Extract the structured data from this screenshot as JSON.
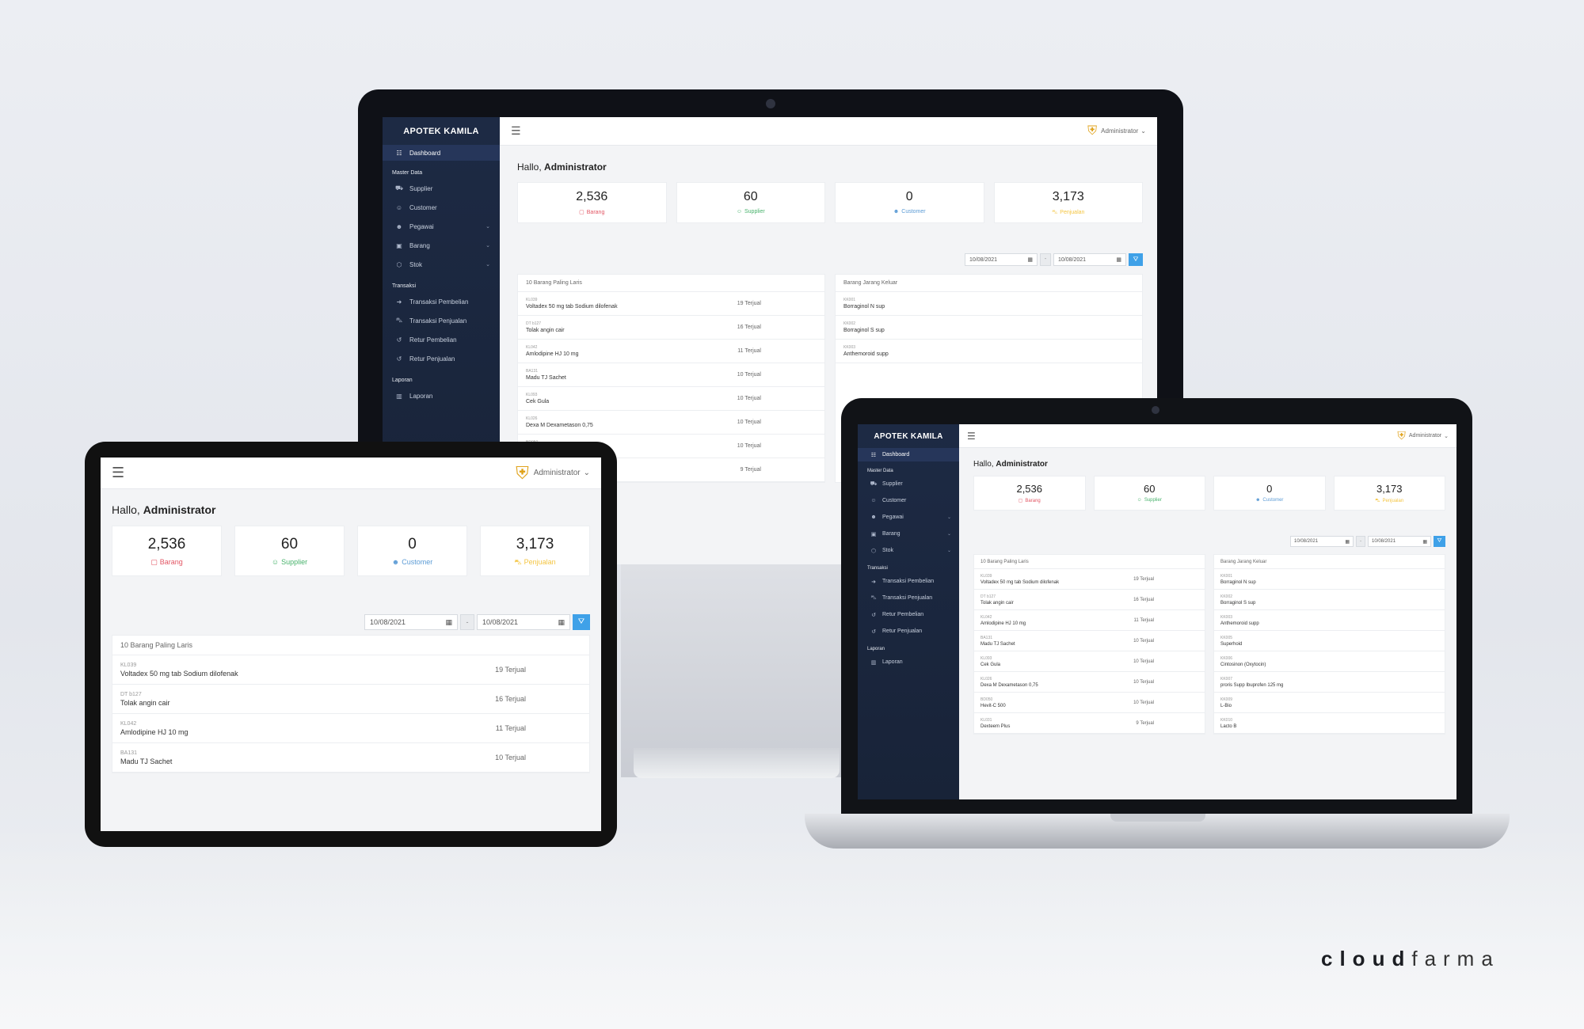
{
  "app": {
    "brand": "APOTEK KAMILA",
    "user": "Administrator",
    "greeting_prefix": "Hallo,",
    "greeting_name": "Administrator",
    "nav": {
      "dashboard": "Dashboard",
      "master_data": "Master Data",
      "supplier": "Supplier",
      "customer": "Customer",
      "pegawai": "Pegawai",
      "barang": "Barang",
      "stok": "Stok",
      "transaksi": "Transaksi",
      "transaksi_pembelian": "Transaksi Pembelian",
      "transaksi_penjualan": "Transaksi Penjualan",
      "retur_pembelian": "Retur Pembelian",
      "retur_penjualan": "Retur Penjualan",
      "laporan_section": "Laporan",
      "laporan": "Laporan"
    },
    "stats": [
      {
        "value": "2,536",
        "label": "Barang",
        "color": "#e25563",
        "icon": "bag-icon"
      },
      {
        "value": "60",
        "label": "Supplier",
        "color": "#47b26b",
        "icon": "user-check-icon"
      },
      {
        "value": "0",
        "label": "Customer",
        "color": "#5b9bd5",
        "icon": "users-icon"
      },
      {
        "value": "3,173",
        "label": "Penjualan",
        "color": "#f4c542",
        "icon": "cart-icon"
      }
    ],
    "filter": {
      "from": "10/08/2021",
      "to": "10/08/2021",
      "separator": "-"
    },
    "laris_title": "10 Barang Paling Laris",
    "jarang_title": "Barang Jarang Keluar",
    "laris": [
      {
        "code": "KL039",
        "name": "Voltadex 50 mg tab Sodium dilofenak",
        "qty": "19 Terjual"
      },
      {
        "code": "DT b127",
        "name": "Tolak angin cair",
        "qty": "16 Terjual"
      },
      {
        "code": "KL042",
        "name": "Amlodipine HJ 10 mg",
        "qty": "11 Terjual"
      },
      {
        "code": "BA131",
        "name": "Madu TJ Sachet",
        "qty": "10 Terjual"
      },
      {
        "code": "KL093",
        "name": "Cek Gula",
        "qty": "10 Terjual"
      },
      {
        "code": "KL026",
        "name": "Dexa M Dexametason 0,75",
        "qty": "10 Terjual"
      },
      {
        "code": "BD050",
        "name": "Hevit-C 500",
        "qty": "10 Terjual"
      },
      {
        "code": "KL031",
        "name": "Dexteem Plus",
        "qty": "9 Terjual"
      }
    ],
    "jarang": [
      {
        "code": "KK001",
        "name": "Borraginol N sup"
      },
      {
        "code": "KK002",
        "name": "Borraginol S sup"
      },
      {
        "code": "KK003",
        "name": "Anthemoroid supp"
      },
      {
        "code": "KK005",
        "name": "Superhoid"
      },
      {
        "code": "KK006",
        "name": "Cintosinon (Oxytocin)"
      },
      {
        "code": "KK007",
        "name": "proris Supp Ibuprofen 125 mg"
      },
      {
        "code": "KK009",
        "name": "L-Bio"
      },
      {
        "code": "KK010",
        "name": "Lacto B"
      }
    ]
  },
  "brandmark": {
    "bold": "cloud",
    "light": "farma"
  }
}
